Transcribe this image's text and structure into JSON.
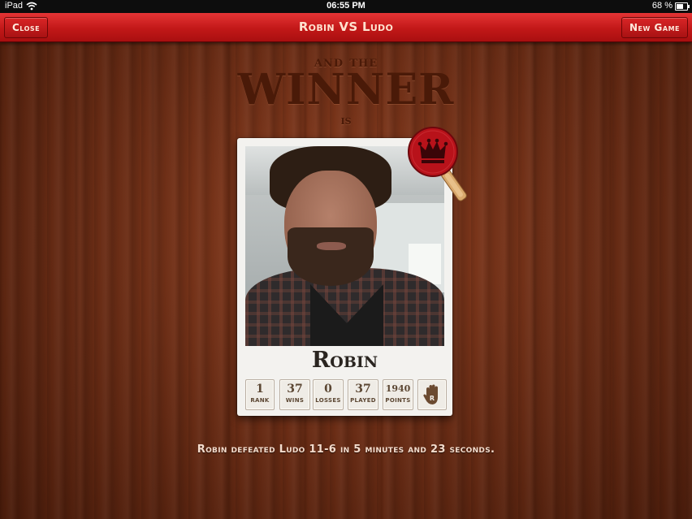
{
  "status_bar": {
    "carrier": "iPad",
    "time": "06:55 PM",
    "battery": "68 %",
    "battery_level": 0.68
  },
  "nav": {
    "close_label": "Close",
    "title": "Robin VS Ludo",
    "new_game_label": "New Game"
  },
  "heading": {
    "line1": "and the",
    "line2": "Winner",
    "line3": "is"
  },
  "winner_card": {
    "name": "Robin",
    "stats": [
      {
        "value": "1",
        "label": "RANK"
      },
      {
        "value": "37",
        "label": "WINS"
      },
      {
        "value": "0",
        "label": "LOSSES"
      },
      {
        "value": "37",
        "label": "PLAYED"
      },
      {
        "value": "1940",
        "label": "POINTS"
      }
    ],
    "hand_icon": "hand-icon",
    "paddle_icon": "crown-paddle-icon"
  },
  "result_text": "Robin defeated Ludo 11-6 in 5 minutes and 23 seconds.",
  "colors": {
    "nav_red": "#c21818",
    "wood": "#6d2e16",
    "paddle_red": "#b8121a"
  }
}
